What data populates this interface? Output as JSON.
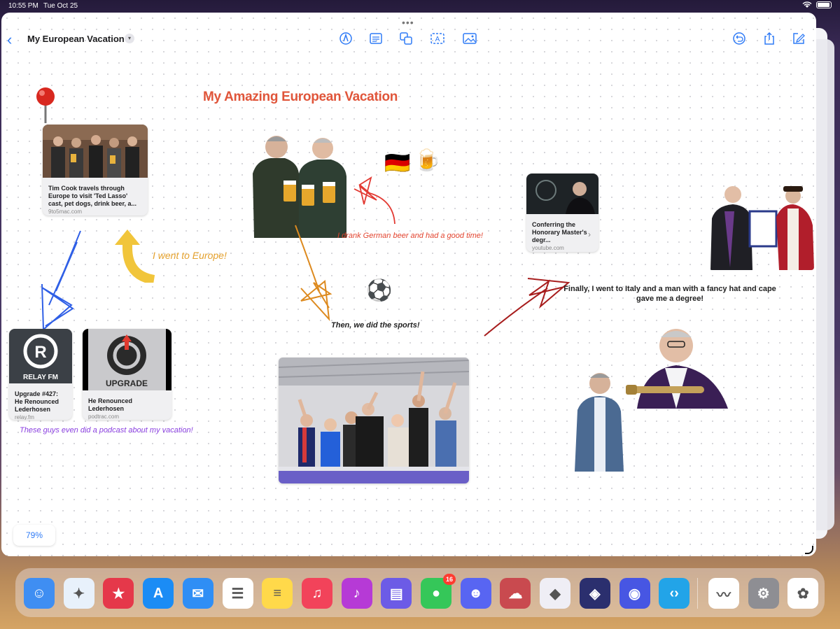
{
  "status_bar": {
    "time": "10:55 PM",
    "date": "Tue Oct 25"
  },
  "toolbar": {
    "title": "My European Vacation",
    "tools": [
      "pen-tool-icon",
      "text-box-icon",
      "shapes-icon",
      "text-icon",
      "media-icon"
    ],
    "right_tools": [
      "undo-icon",
      "share-icon",
      "compose-icon"
    ]
  },
  "board": {
    "main_title": "My Amazing European Vacation",
    "link_cards": [
      {
        "title": "Tim Cook travels through Europe to visit 'Ted Lasso' cast, pet dogs, drink beer, a...",
        "domain": "9to5mac.com"
      },
      {
        "title": "Conferring the Honorary Master's degr...",
        "domain": "youtube.com"
      },
      {
        "title": "Upgrade #427: He Renounced Lederhosen",
        "domain": "relay.fm",
        "thumb_label": "RELAY FM"
      },
      {
        "title": "He Renounced Lederhosen",
        "domain": "podtrac.com",
        "thumb_label": "UPGRADE"
      }
    ],
    "notes": {
      "europe": "I went to Europe!",
      "beer": "I drank German beer and had a good time!",
      "sports": "Then, we did the sports!",
      "italy": "Finally, I went to Italy and a man with a fancy hat and cape gave me a degree!",
      "podcast": "These guys even did a podcast about my vacation!"
    },
    "emoji": {
      "flag": "🇩🇪",
      "beer": "🍺",
      "ball": "⚽"
    },
    "zoom": "79%"
  },
  "dock": {
    "apps": [
      {
        "name": "finder-icon",
        "color": "#3f8ef2"
      },
      {
        "name": "safari-icon",
        "color": "#e8f1fb"
      },
      {
        "name": "bookmark-app-icon",
        "color": "#e5384a"
      },
      {
        "name": "app-store-icon",
        "color": "#1b8cf5"
      },
      {
        "name": "mail-icon",
        "color": "#2f8ef5"
      },
      {
        "name": "reminders-icon",
        "color": "#ffffff"
      },
      {
        "name": "notes-icon",
        "color": "#ffd94a"
      },
      {
        "name": "music-icon",
        "color": "#f2435a"
      },
      {
        "name": "podcast-player-icon",
        "color": "#b63ad6"
      },
      {
        "name": "archive-app-icon",
        "color": "#6c5be6"
      },
      {
        "name": "messages-icon",
        "color": "#35c759",
        "badge": "16"
      },
      {
        "name": "discord-icon",
        "color": "#5865f2"
      },
      {
        "name": "cloud-app-icon",
        "color": "#c94a4f"
      },
      {
        "name": "obsidian-icon",
        "color": "#efeef5"
      },
      {
        "name": "shortcuts-icon",
        "color": "#2b2f6e"
      },
      {
        "name": "robot-app-icon",
        "color": "#4756e3"
      },
      {
        "name": "remote-app-icon",
        "color": "#22a4e8"
      },
      {
        "name": "freeform-icon",
        "color": "#ffffff"
      },
      {
        "name": "settings-icon",
        "color": "#8e8e93"
      },
      {
        "name": "photos-icon",
        "color": "#ffffff"
      }
    ]
  }
}
